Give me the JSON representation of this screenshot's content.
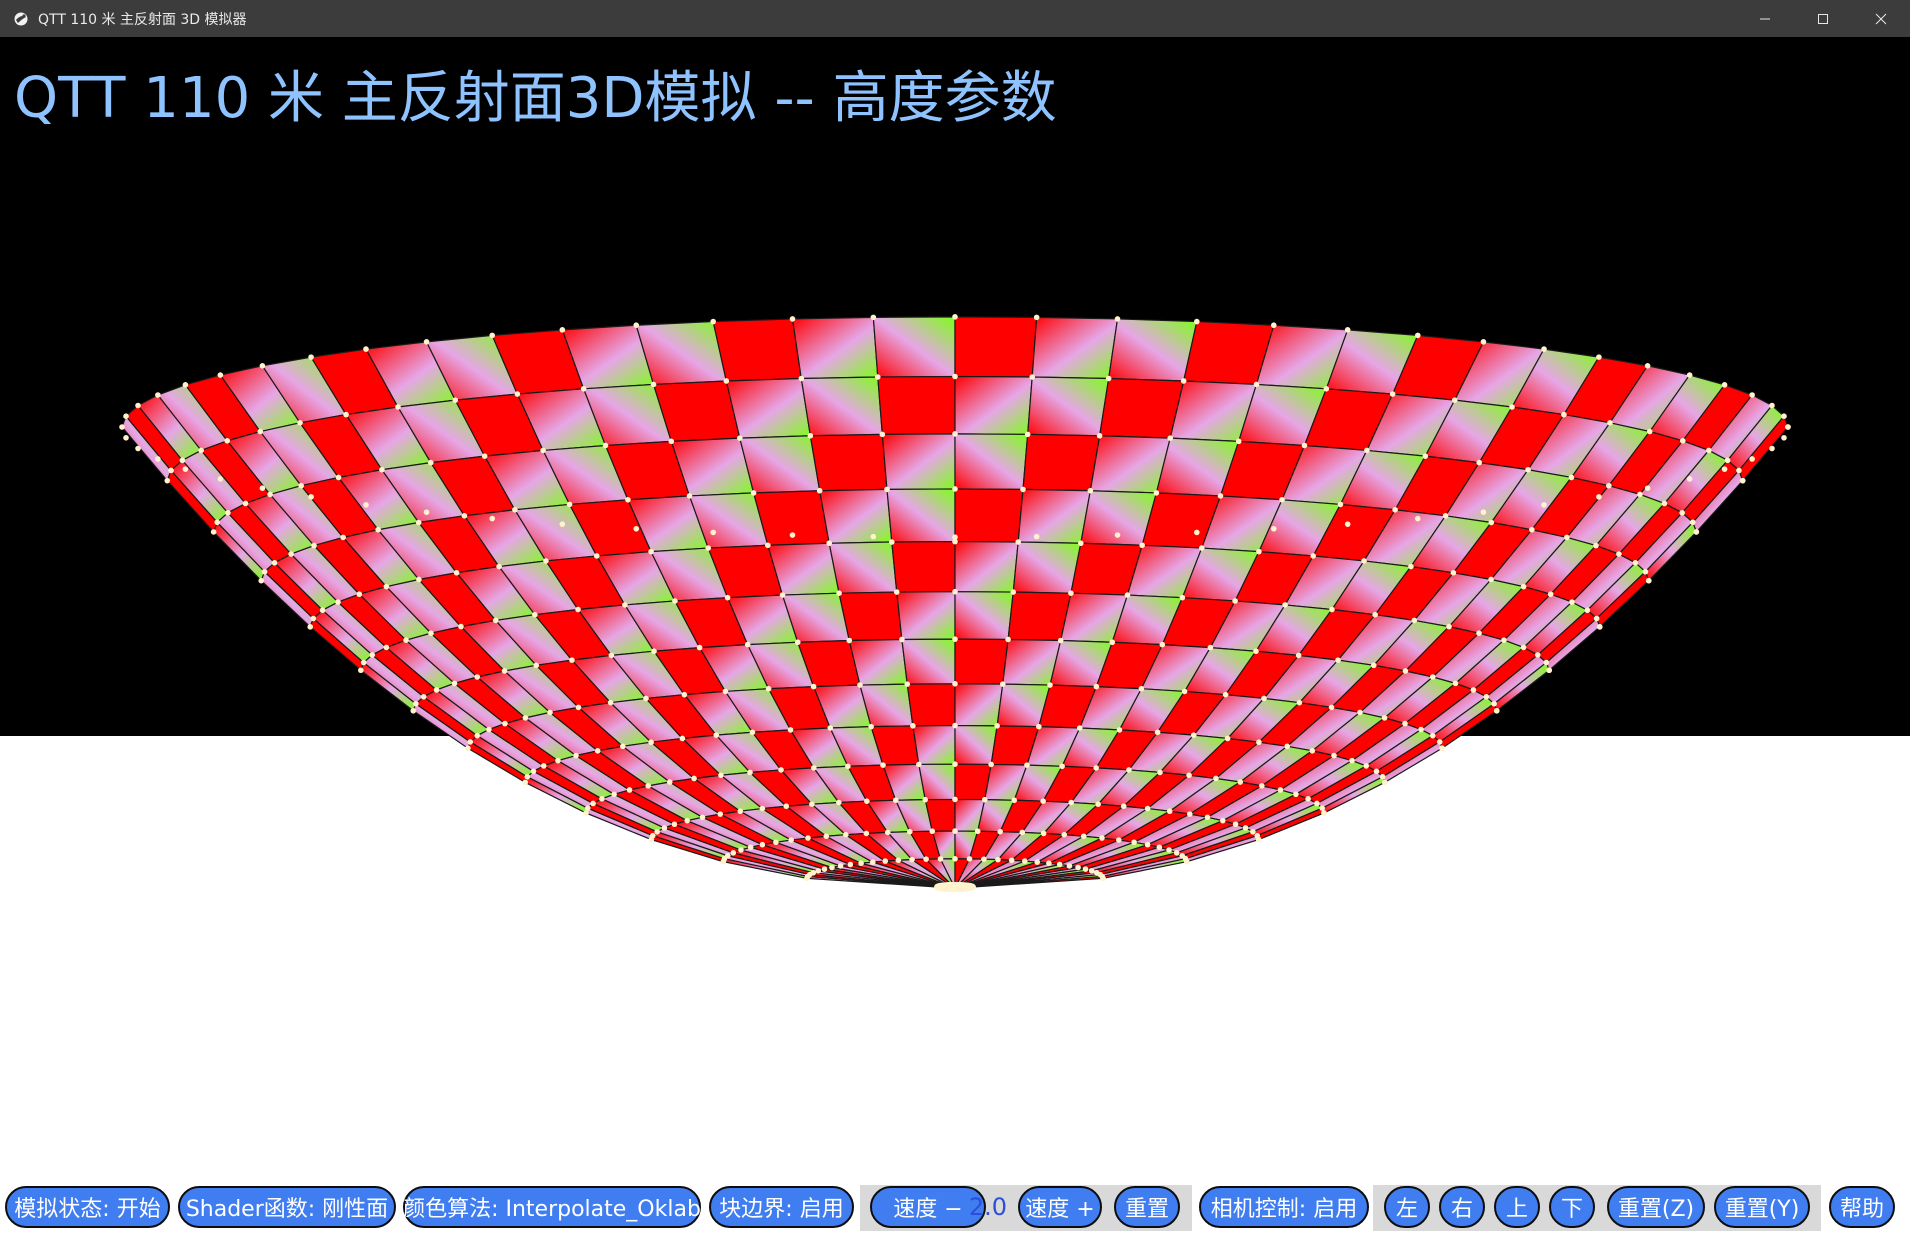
{
  "window": {
    "title": "QTT 110 米 主反射面 3D 模拟器",
    "icon": "app-logo-icon",
    "controls": [
      "minimize-icon",
      "maximize-icon",
      "close-icon"
    ]
  },
  "scene": {
    "title": "QTT 110 米 主反射面3D模拟 -- 高度参数",
    "colors": {
      "sky": "#000000",
      "ground": "#ffffff",
      "title": "#8ec3ff",
      "panel_red": "#ff0000",
      "panel_green": "#7dff1a",
      "panel_pink": "#e6a6e6",
      "node": "#fff2cc"
    }
  },
  "toolbar": {
    "sim_state": "模拟状态: 开始",
    "shader_fn": "Shader函数: 刚性面",
    "color_algo": "颜色算法: Interpolate_Oklab",
    "block_border": "块边界: 启用",
    "speed_minus": "速度 −",
    "speed_value": "2.0",
    "speed_plus": "速度 +",
    "speed_reset": "重置",
    "camera_control": "相机控制: 启用",
    "left": "左",
    "right": "右",
    "up": "上",
    "down": "下",
    "reset_z": "重置(Z)",
    "reset_y": "重置(Y)",
    "help": "帮助",
    "button_color": "#3f7df1",
    "group_color": "#d9d9d9"
  }
}
